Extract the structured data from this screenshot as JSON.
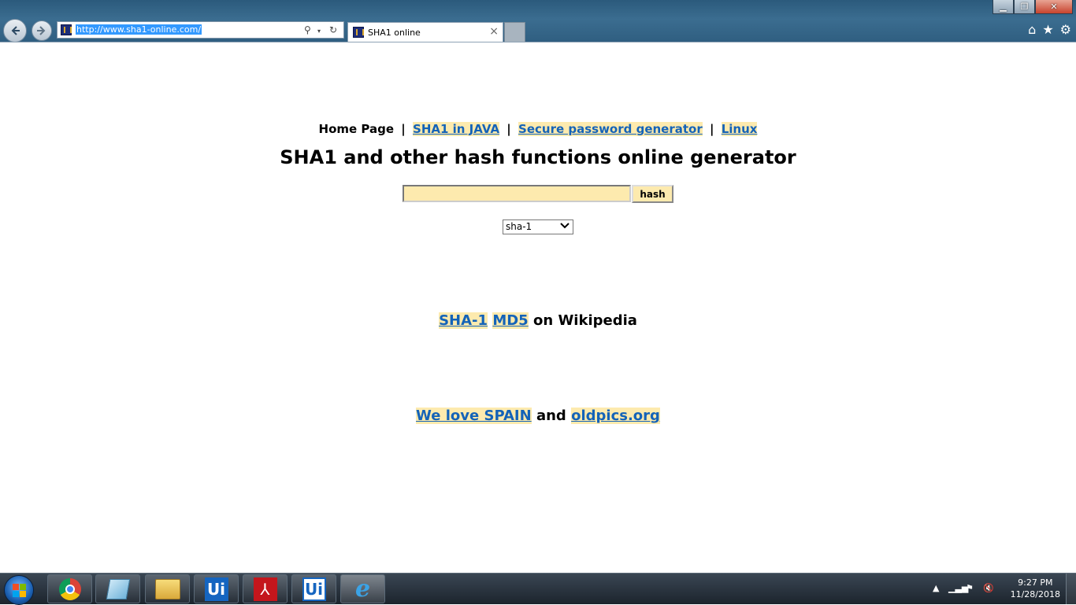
{
  "browser": {
    "address": "http://www.sha1-online.com/",
    "tab_title": "SHA1 online",
    "tab_close": "×",
    "back_icon": "back-arrow-icon",
    "forward_icon": "forward-arrow-icon",
    "search_glyph": "⚲",
    "dropdown_glyph": "▾",
    "refresh_glyph": "↻",
    "home_glyph": "⌂",
    "favorites_glyph": "★",
    "tools_glyph": "⚙",
    "minimize_glyph": "▁",
    "restore_glyph": "❐",
    "close_glyph": "✕"
  },
  "nav": {
    "home": "Home Page",
    "separator": "|",
    "links": [
      {
        "label": "SHA1 in JAVA"
      },
      {
        "label": "Secure password generator"
      },
      {
        "label": "Linux"
      }
    ]
  },
  "page": {
    "title": "SHA1 and other hash functions online generator",
    "input_value": "",
    "hash_button": "hash",
    "algorithm_selected": "sha-1",
    "select_arrow": "⌄"
  },
  "wiki": {
    "link1": "SHA-1",
    "link2": "MD5",
    "suffix": "on Wikipedia"
  },
  "footer_links": {
    "link1": "We love SPAIN",
    "connector": "and",
    "link2": "oldpics.org"
  },
  "taskbar": {
    "apps": [
      "chrome-icon",
      "sticky-notes-icon",
      "file-explorer-icon",
      "uipath-icon",
      "acrobat-icon",
      "uipath-studio-icon",
      "internet-explorer-icon"
    ],
    "ui_label_1": "Ui",
    "ui_label_2": "Ui",
    "acrobat_glyph": "⅄",
    "ie_glyph": "e",
    "tray_arrow": "▲",
    "tray_signal": "▁▃▅",
    "tray_flag": "⚑",
    "tray_sound": "🔇",
    "time": "9:27 PM",
    "date": "11/28/2018"
  },
  "colors": {
    "link": "#1463b8",
    "link_highlight": "#fdeaae",
    "input_background": "#fdeaae"
  }
}
